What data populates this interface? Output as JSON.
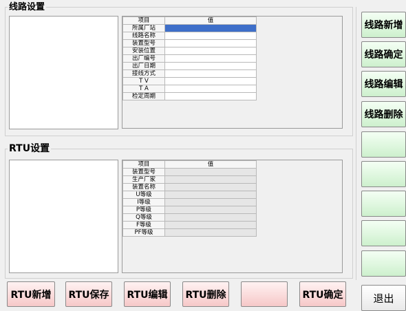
{
  "line_settings": {
    "title": "线路设置",
    "table": {
      "header": [
        "项目",
        "值"
      ],
      "rows": [
        "所属厂站",
        "线路名称",
        "装置型号",
        "安装位置",
        "出厂编号",
        "出厂日期",
        "接线方式",
        "T V",
        "T A",
        "检定周期"
      ]
    }
  },
  "rtu_settings": {
    "title": "RTU设置",
    "table": {
      "header": [
        "项目",
        "值"
      ],
      "rows": [
        "装置型号",
        "生产厂家",
        "装置名称",
        "U等级",
        "I等级",
        "P等级",
        "Q等级",
        "F等级",
        "PF等级"
      ]
    }
  },
  "right_buttons": [
    "线路新增",
    "线路确定",
    "线路编辑",
    "线路删除",
    "",
    "",
    "",
    "",
    ""
  ],
  "bottom_buttons": [
    "RTU新增",
    "RTU保存",
    "RTU编辑",
    "RTU删除",
    "",
    "RTU确定"
  ],
  "exit_label": "退出",
  "colors": {
    "selection": "#3e6fc9",
    "pink_button": "#f6c8c8",
    "green_button": "#cdf0cd"
  }
}
